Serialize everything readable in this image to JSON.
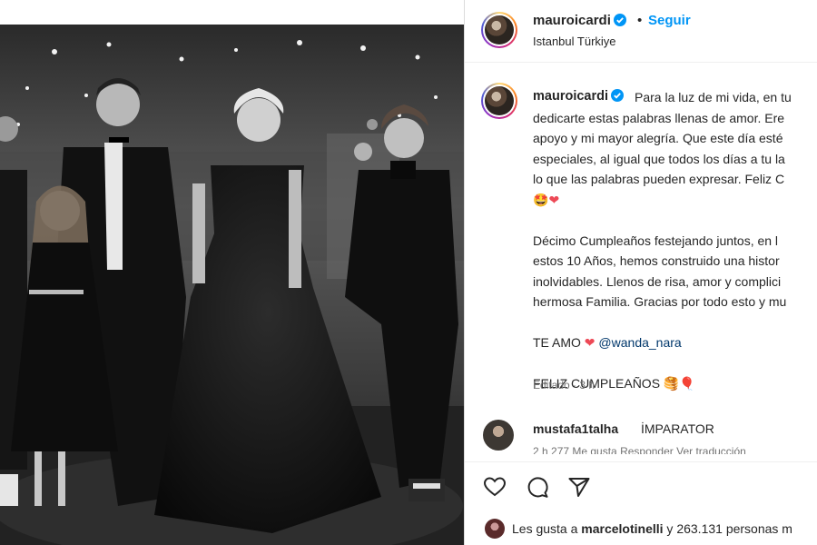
{
  "post": {
    "author": "mauroicardi",
    "verified": true,
    "dot": "•",
    "follow_label": "Seguir",
    "location": "Istanbul Türkiye"
  },
  "caption": {
    "username": "mauroicardi",
    "para1": "Para la luz de mi vida, en tu\ndedicarte estas palabras llenas de amor. Ere\napoyo y mi mayor alegría. Que este día esté\nespeciales, al igual que todos los días a tu la\nlo que las palabras pueden expresar. Feliz C",
    "para1_emoji": "🤩",
    "para1_heart": "❤",
    "para2": "Décimo Cumpleaños festejando juntos, en l\nestos 10 Años, hemos construido una histor\ninolvidables. Llenos de risa, amor y complici\nhermosa Familia. Gracias por todo esto y mu",
    "te_amo": "TE AMO",
    "te_amo_heart": "❤",
    "mention": "@wanda_nara",
    "feliz": "FELIZ CUMPLEAÑOS",
    "feliz_emojis": "🥞🎈",
    "edited": "Editado · 3 h"
  },
  "comment": {
    "username": "mustafa1talha",
    "text": "İMPARATOR",
    "meta": "2 h   277 Me gusta   Responder   Ver traducción"
  },
  "actions": {
    "like_icon": "heart-outline-icon",
    "comment_icon": "comment-bubble-icon",
    "share_icon": "paper-plane-icon"
  },
  "likes": {
    "prefix": "Les gusta a ",
    "user": "marcelotinelli",
    "suffix": " y 263.131 personas m"
  },
  "colors": {
    "accent": "#0095f6",
    "heart": "#ed4956",
    "mention": "#00376b"
  }
}
